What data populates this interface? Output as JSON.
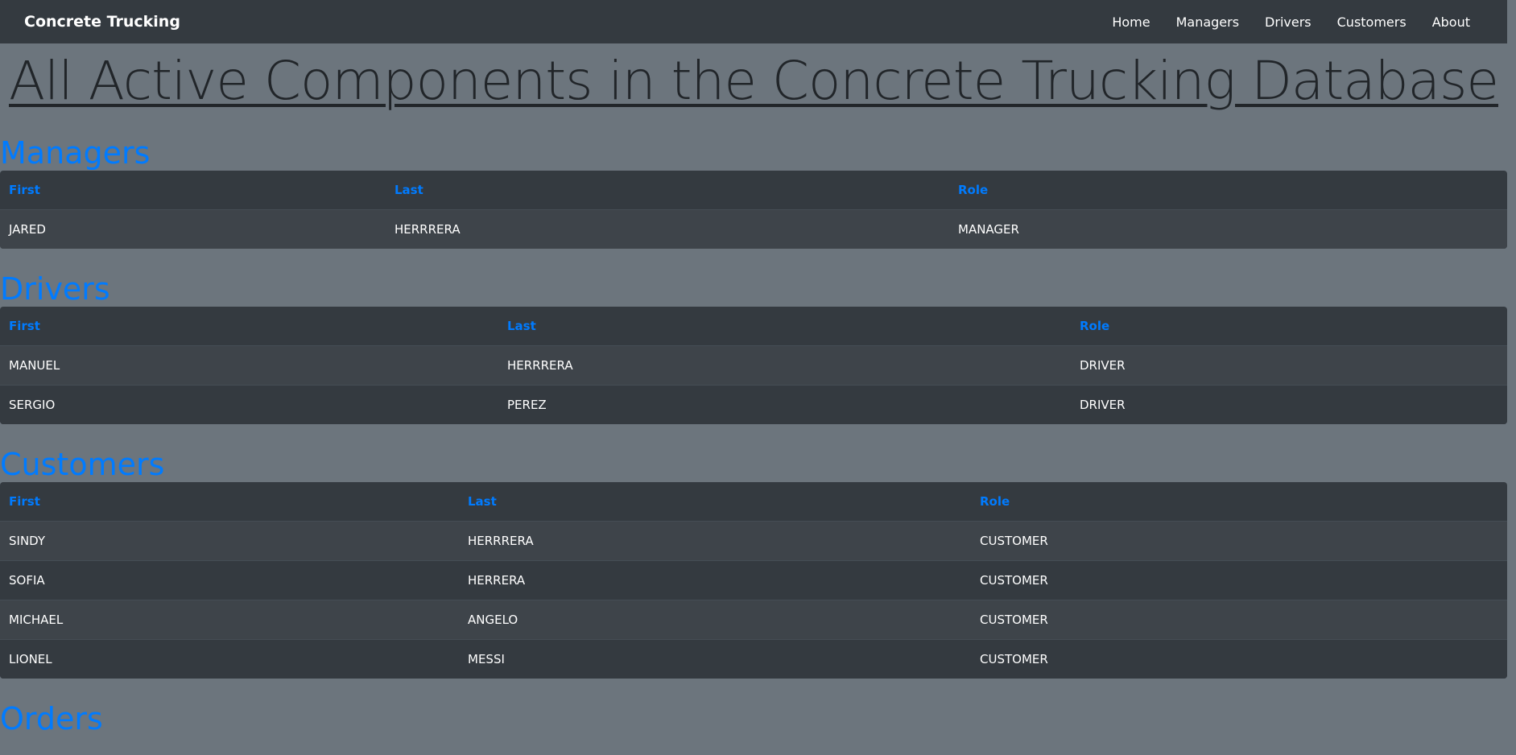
{
  "navbar": {
    "brand": "Concrete Trucking",
    "links": [
      "Home",
      "Managers",
      "Drivers",
      "Customers",
      "About"
    ]
  },
  "main_title": "All Active Components in the Concrete Trucking Database",
  "managers": {
    "title": "Managers",
    "headers": [
      "First",
      "Last",
      "Role"
    ],
    "rows": [
      [
        "JARED",
        "HERRRERA",
        "MANAGER"
      ]
    ]
  },
  "drivers": {
    "title": "Drivers",
    "headers": [
      "First",
      "Last",
      "Role"
    ],
    "rows": [
      [
        "MANUEL",
        "HERRRERA",
        "DRIVER"
      ],
      [
        "SERGIO",
        "PEREZ",
        "DRIVER"
      ]
    ]
  },
  "customers": {
    "title": "Customers",
    "headers": [
      "First",
      "Last",
      "Role"
    ],
    "rows": [
      [
        "SINDY",
        "HERRRERA",
        "CUSTOMER"
      ],
      [
        "SOFIA",
        "HERRERA",
        "CUSTOMER"
      ],
      [
        "MICHAEL",
        "ANGELO",
        "CUSTOMER"
      ],
      [
        "LIONEL",
        "MESSI",
        "CUSTOMER"
      ]
    ]
  },
  "orders": {
    "title": "Orders"
  },
  "colors": {
    "background": "#6c757d",
    "navbar": "#343a40",
    "accent": "#007bff",
    "table_bg": "#343a40",
    "table_stripe": "#3e444a"
  }
}
